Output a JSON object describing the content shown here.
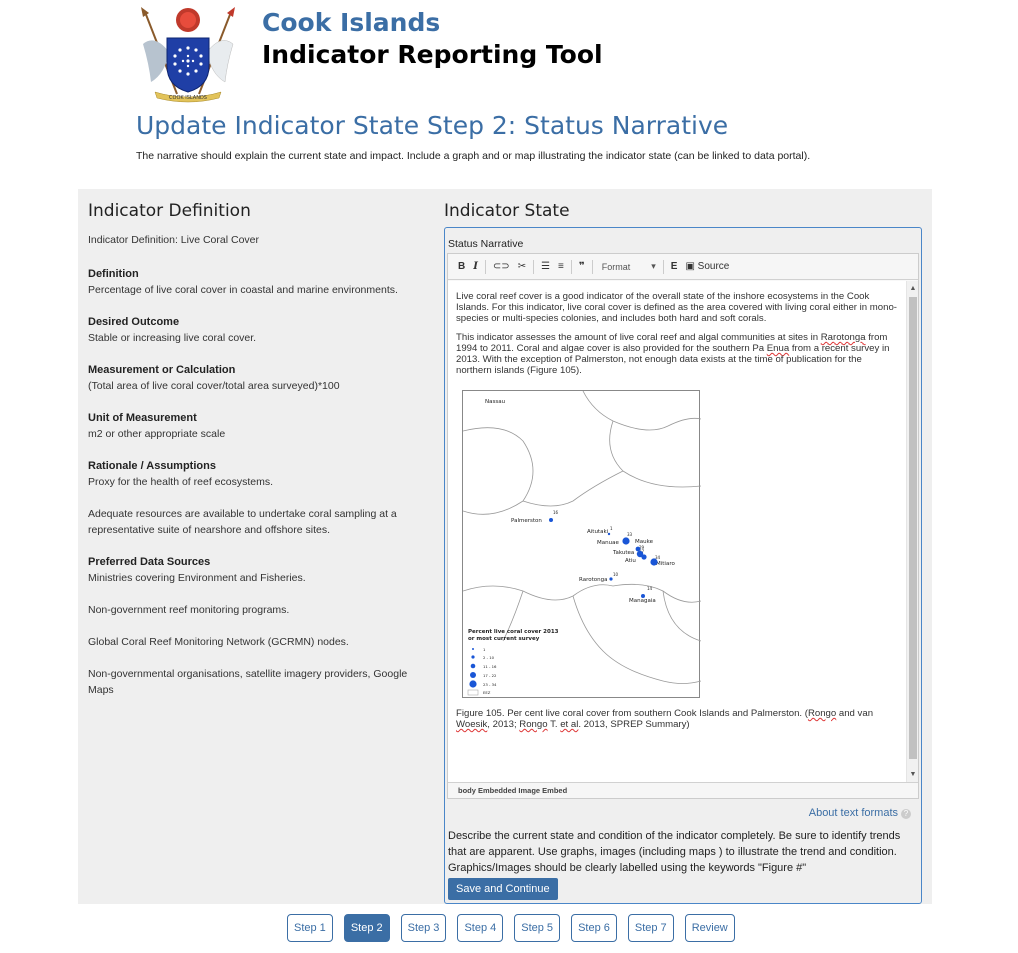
{
  "brand": {
    "title": "Cook Islands",
    "subtitle": "Indicator Reporting Tool",
    "logo_caption": "COOK ISLANDS"
  },
  "page": {
    "title": "Update Indicator State Step 2: Status Narrative",
    "intro": "The narrative should explain the current state and impact. Include a graph and or map illustrating the indicator state (can be linked to data portal)."
  },
  "definition": {
    "heading": "Indicator Definition",
    "line": "Indicator Definition: Live Coral Cover",
    "sections": [
      {
        "title": "Definition",
        "paras": [
          "Percentage of live coral cover in coastal and marine environments."
        ]
      },
      {
        "title": "Desired Outcome",
        "paras": [
          "Stable or increasing live coral cover."
        ]
      },
      {
        "title": "Measurement or Calculation",
        "paras": [
          "(Total area of live coral cover/total area surveyed)*100"
        ]
      },
      {
        "title": "Unit of Measurement",
        "paras": [
          "m2 or other appropriate scale"
        ]
      },
      {
        "title": "Rationale / Assumptions",
        "paras": [
          "Proxy for the health of reef ecosystems.",
          "Adequate resources are available to undertake coral sampling at a representative suite of nearshore and offshore sites."
        ]
      },
      {
        "title": "Preferred Data Sources",
        "paras": [
          "Ministries covering Environment and Fisheries.",
          "Non-government reef monitoring programs.",
          "Global Coral Reef Monitoring Network (GCRMN) nodes.",
          "Non-governmental organisations, satellite imagery providers, Google Maps"
        ]
      }
    ]
  },
  "state": {
    "heading": "Indicator State",
    "field_label": "Status Narrative",
    "toolbar": {
      "bold": "B",
      "italic": "I",
      "link": "⊂⊃",
      "unlink": "✂",
      "bullets": "☰",
      "numbers": "≡",
      "quote": "❞",
      "format": "Format",
      "embed": "E",
      "source": "Source"
    },
    "para1": "Live coral reef cover is a good indicator of the overall state of the inshore ecosystems in the Cook Islands. For this indicator, live coral cover is defined as the area covered with living coral either in mono-species or multi-species colonies, and includes both hard and soft corals.",
    "para2_a": "This indicator assesses the amount of live coral reef and algal communities at sites in ",
    "para2_rarotonga": "Rarotonga",
    "para2_b": " from 1994 to 2011. Coral and algae cover is also provided for the southern Pa ",
    "para2_enua": "Enua",
    "para2_c": " from a recent survey in 2013. With the exception of Palmerston, not enough data exists at the time of publication for the northern islands (Figure 105).",
    "caption_a": "Figure 105. Per cent live coral cover from southern Cook Islands and Palmerston. (",
    "caption_rongo1": "Rongo",
    "caption_b": " and van ",
    "caption_woesik": "Woesik",
    "caption_c": ", 2013; ",
    "caption_rongo2": "Rongo",
    "caption_d": " T. ",
    "caption_etal": "et al",
    "caption_e": ". 2013, SPREP Summary)",
    "pathbar": "body   Embedded Image Embed",
    "about": "About text formats",
    "help": "?",
    "description": "Describe the current state and condition of the indicator completely. Be sure to identify trends that are apparent. Use graphs, images (including maps ) to illustrate the trend and condition. Graphics/Images should be clearly labelled using the keywords \"Figure #\"",
    "save_label": "Save and Continue"
  },
  "map": {
    "islands": [
      {
        "name": "Nassau",
        "value": ""
      },
      {
        "name": "Palmerston",
        "value": "16"
      },
      {
        "name": "Aitutaki",
        "value": "1"
      },
      {
        "name": "Manuae",
        "value": "33"
      },
      {
        "name": "Mauke",
        "value": ""
      },
      {
        "name": "Takutea",
        "value": ""
      },
      {
        "name": "Atiu",
        "value": ""
      },
      {
        "name": "Mitiaro",
        "value": "34"
      },
      {
        "name": "Rarotonga",
        "value": "10"
      },
      {
        "name": "Managaia",
        "value": "14"
      }
    ],
    "extra_labels": [
      "29",
      "27"
    ],
    "legend_title_1": "Percent live coral cover 2013",
    "legend_title_2": "or most current survey",
    "legend_items": [
      "1",
      "2 - 10",
      "11 - 16",
      "17 - 22",
      "23 - 34",
      "EEZ"
    ]
  },
  "steps": [
    {
      "label": "Step 1",
      "active": false
    },
    {
      "label": "Step 2",
      "active": true
    },
    {
      "label": "Step 3",
      "active": false
    },
    {
      "label": "Step 4",
      "active": false
    },
    {
      "label": "Step 5",
      "active": false
    },
    {
      "label": "Step 6",
      "active": false
    },
    {
      "label": "Step 7",
      "active": false
    },
    {
      "label": "Review",
      "active": false
    }
  ],
  "colors": {
    "accent": "#3b6ea5",
    "panel": "#efefef",
    "map_dot": "#1a56d6"
  }
}
